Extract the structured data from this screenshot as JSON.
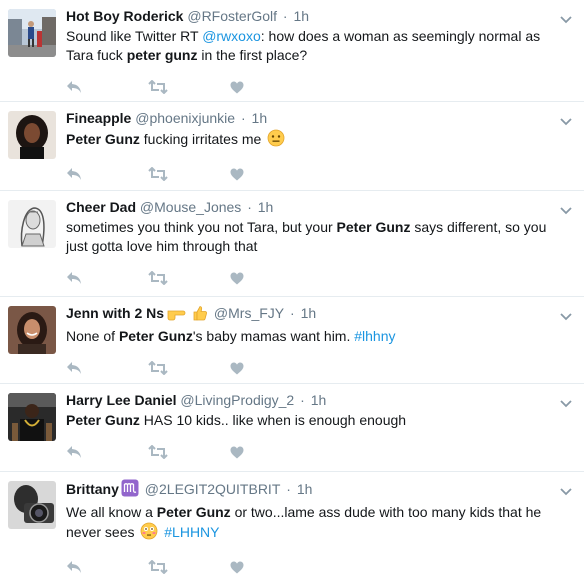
{
  "colors": {
    "link": "#1b95e0",
    "meta": "#657786",
    "icon": "#aab8c2",
    "divider": "#e6ecf0"
  },
  "icons": {
    "reply": "reply-icon",
    "retweet": "retweet-icon",
    "like": "heart-icon",
    "menu": "chevron-down-icon"
  },
  "tweets": [
    {
      "name": "Hot Boy Roderick",
      "handle": "@RFosterGolf",
      "time": "1h",
      "segments": [
        {
          "t": "Sound like Twitter RT "
        },
        {
          "t": "@rwxoxo",
          "s": "link"
        },
        {
          "t": ": how does a woman as seemingly normal as Tara fuck "
        },
        {
          "t": "peter gunz",
          "s": "bold"
        },
        {
          "t": " in the first place?"
        }
      ]
    },
    {
      "name": "Fineapple",
      "handle": "@phoenixjunkie",
      "time": "1h",
      "segments": [
        {
          "t": "Peter Gunz",
          "s": "bold"
        },
        {
          "t": " fucking irritates me "
        },
        {
          "e": "neutral-face-emoji"
        }
      ]
    },
    {
      "name": "Cheer Dad",
      "handle": "@Mouse_Jones",
      "time": "1h",
      "segments": [
        {
          "t": "sometimes you think you not Tara, but your "
        },
        {
          "t": "Peter Gunz",
          "s": "bold"
        },
        {
          "t": " says different, so you just gotta love him through that"
        }
      ]
    },
    {
      "name": "Jenn with 2 Ns",
      "name_emoji": [
        "point-right-emoji",
        "thumbs-up-emoji"
      ],
      "handle": "@Mrs_FJY",
      "time": "1h",
      "segments": [
        {
          "t": "None of "
        },
        {
          "t": "Peter Gunz",
          "s": "bold"
        },
        {
          "t": "'s baby mamas want him. "
        },
        {
          "t": "#lhhny",
          "s": "link"
        }
      ]
    },
    {
      "name": "Harry Lee Daniel",
      "handle": "@LivingProdigy_2",
      "time": "1h",
      "segments": [
        {
          "t": "Peter Gunz",
          "s": "bold"
        },
        {
          "t": " HAS 10 kids.. like when is enough enough"
        }
      ]
    },
    {
      "name": "Brittany",
      "name_emoji": [
        "virgo-emoji"
      ],
      "handle": "@2LEGIT2QUITBRIT",
      "time": "1h",
      "segments": [
        {
          "t": "We all know a "
        },
        {
          "t": "Peter Gunz",
          "s": "bold"
        },
        {
          "t": " or two...lame ass dude with too many kids that he never sees "
        },
        {
          "e": "flushed-face-emoji"
        },
        {
          "t": " "
        },
        {
          "t": "#LHHNY",
          "s": "link"
        }
      ]
    }
  ]
}
